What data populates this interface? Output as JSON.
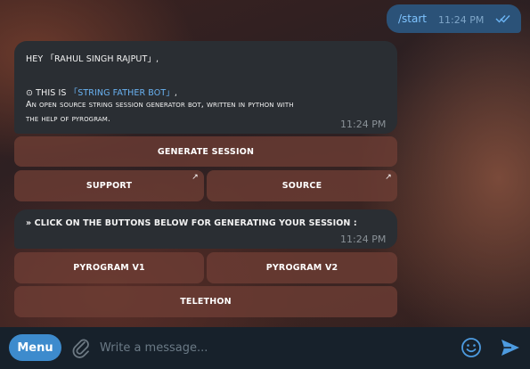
{
  "outgoing": {
    "text": "/start",
    "time": "11:24 PM"
  },
  "message1": {
    "line1_prefix": "HEY ",
    "line1_name": "「RAHUL SINGH RAJPUT」,",
    "line3_prefix": "⊙ THIS IS ",
    "line3_link": "「STRING FATHER BOT」",
    "line3_suffix": ",",
    "line4": "An open source string session generator bot, written in python with",
    "line5": "the help of pyrogram.",
    "time": "11:24 PM"
  },
  "keyboard1": {
    "generate": "GENERATE SESSION",
    "support": "SUPPORT",
    "source": "SOURCE",
    "arrow": "↗"
  },
  "message2": {
    "text": "» CLICK ON THE BUTTONS BELOW FOR GENERATING YOUR SESSION :",
    "time": "11:24 PM"
  },
  "keyboard2": {
    "pyrogram_v1": "PYROGRAM V1",
    "pyrogram_v2": "PYROGRAM V2",
    "telethon": "TELETHON"
  },
  "bottombar": {
    "menu_label": "Menu",
    "placeholder": "Write a message..."
  },
  "colors": {
    "accent": "#3d8bcd",
    "link": "#6ab3f3",
    "outgoing_bubble": "#2b5278",
    "incoming_bubble": "#2a2e33"
  }
}
